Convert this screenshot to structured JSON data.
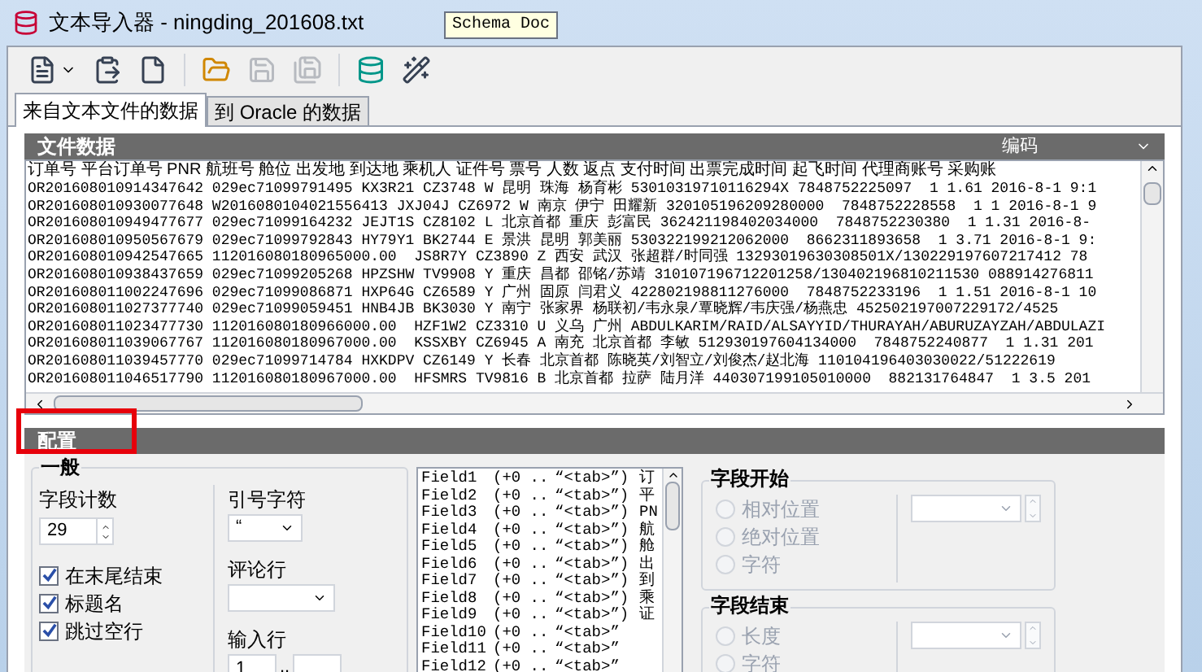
{
  "window": {
    "title": "文本导入器 - ningding_201608.txt"
  },
  "tooltip": {
    "text": "Schema Doc"
  },
  "toolbar": [
    [
      {
        "kind": "open",
        "disabled": false,
        "menu": true
      },
      {
        "kind": "paste",
        "disabled": false,
        "menu": false
      },
      {
        "kind": "new",
        "disabled": false,
        "menu": false
      }
    ],
    [
      {
        "kind": "folder",
        "disabled": false,
        "menu": false
      },
      {
        "kind": "save",
        "disabled": true,
        "menu": false
      },
      {
        "kind": "saveas",
        "disabled": true,
        "menu": false
      }
    ],
    [
      {
        "kind": "database",
        "disabled": false,
        "menu": false
      },
      {
        "kind": "wand",
        "disabled": false,
        "menu": false
      }
    ]
  ],
  "tabs": [
    {
      "label": "来自文本文件的数据",
      "selected": true
    },
    {
      "label": "到 Oracle 的数据",
      "selected": false
    }
  ],
  "file_data": {
    "title": "文件数据",
    "encoding_label": "编码",
    "header": "订单号 平台订单号 PNR 航班号 舱位 出发地 到达地 乘机人 证件号 票号 人数 返点 支付时间 出票完成时间 起飞时间 代理商账号 采购账",
    "rows": [
      "OR201608010914347642 029ec71099791495 KX3R21 CZ3748 W 昆明 珠海 杨育彬 53010319710116294X 7848752225097  1 1.61 2016-8-1 9:1",
      "OR201608010930077648 W2016080104021556413 JXJ04J CZ6972 W 南京 伊宁 田耀新 320105196209280000  7848752228558  1 1 2016-8-1 9",
      "OR201608010949477677 029ec71099164232 JEJT1S CZ8102 L 北京首都 重庆 彭富民 362421198402034000  7848752230380  1 1.31 2016-8-",
      "OR201608010950567679 029ec71099792843 HY79Y1 BK2744 E 景洪 昆明 郭美丽 530322199212062000  8662311893658  1 3.71 2016-8-1 9:",
      "OR201608010942547665 112016080180965000.00  JS8R7Y CZ3890 Z 西安 武汉 张超群/时同强 13293019630308501X/130229197607217412 78",
      "OR201608010938437659 029ec71099205268 HPZSHW TV9908 Y 重庆 昌都 邵铭/苏靖 310107196712201258/130402196810211530 088914276811",
      "OR201608011002247696 029ec71099086871 HXP64G CZ6589 Y 广州 固原 闫君义 422802198811276000  7848752233196  1 1.51 2016-8-1 10",
      "OR201608011027377740 029ec71099059451 HNB4JB BK3030 Y 南宁 张家界 杨联初/韦永泉/覃晓辉/韦庆强/杨燕忠 452502197007229172/4525",
      "OR201608011023477730 112016080180966000.00  HZF1W2 CZ3310 U 义乌 广州 ABDULKARIM/RAID/ALSAYYID/THURAYAH/ABURUZAYZAH/ABDULAZI",
      "OR201608011039067767 112016080180967000.00  KSSXBY CZ6945 A 南充 北京首都 李敏 512930197604134000  7848752240877  1 1.31 201",
      "OR201608011039457770 029ec71099714784 HXKDPV CZ6149 Y 长春 北京首都 陈晓英/刘智立/刘俊杰/赵北海 110104196403030022/51222619",
      "OR201608011046517790 112016080180967000.00  HFSMRS TV9816 B 北京首都 拉萨 陆月洋 440307199105010000  882131764847  1 3.5 201"
    ]
  },
  "config": {
    "title": "配置",
    "highlighted": true,
    "general": {
      "title": "一般",
      "field_count_label": "字段计数",
      "field_count": "29",
      "checkboxes": [
        {
          "label": "在末尾结束",
          "checked": true
        },
        {
          "label": "标题名",
          "checked": true
        },
        {
          "label": "跳过空行",
          "checked": true
        }
      ],
      "quote_label": "引号字符",
      "quote_value": "“",
      "comment_label": "评论行",
      "input_rows_label": "输入行",
      "input_from": "1",
      "input_range_sep": ".."
    },
    "fields": [
      {
        "name": "Field1",
        "range": "(+0 ..",
        "delimiter": "“<tab>”)",
        "sample": "订"
      },
      {
        "name": "Field2",
        "range": "(+0 ..",
        "delimiter": "“<tab>”)",
        "sample": "平"
      },
      {
        "name": "Field3",
        "range": "(+0 ..",
        "delimiter": "“<tab>”)",
        "sample": "PN"
      },
      {
        "name": "Field4",
        "range": "(+0 ..",
        "delimiter": "“<tab>”)",
        "sample": "航"
      },
      {
        "name": "Field5",
        "range": "(+0 ..",
        "delimiter": "“<tab>”)",
        "sample": "舱"
      },
      {
        "name": "Field6",
        "range": "(+0 ..",
        "delimiter": "“<tab>”)",
        "sample": "出"
      },
      {
        "name": "Field7",
        "range": "(+0 ..",
        "delimiter": "“<tab>”)",
        "sample": "到"
      },
      {
        "name": "Field8",
        "range": "(+0 ..",
        "delimiter": "“<tab>”)",
        "sample": "乘"
      },
      {
        "name": "Field9",
        "range": "(+0 ..",
        "delimiter": "“<tab>”)",
        "sample": "证"
      },
      {
        "name": "Field10",
        "range": "(+0 ..",
        "delimiter": "“<tab>”"
      },
      {
        "name": "Field11",
        "range": "(+0 ..",
        "delimiter": "“<tab>”"
      },
      {
        "name": "Field12",
        "range": "(+0 ..",
        "delimiter": "“<tab>”"
      }
    ],
    "field_start": {
      "title": "字段开始",
      "options": [
        {
          "label": "相对位置",
          "selected": false,
          "disabled": true
        },
        {
          "label": "绝对位置",
          "selected": false,
          "disabled": true
        },
        {
          "label": "字符",
          "selected": false,
          "disabled": true
        }
      ]
    },
    "field_end": {
      "title": "字段结束",
      "options": [
        {
          "label": "长度",
          "selected": false,
          "disabled": true
        },
        {
          "label": "字符",
          "selected": false,
          "disabled": true
        }
      ]
    }
  }
}
